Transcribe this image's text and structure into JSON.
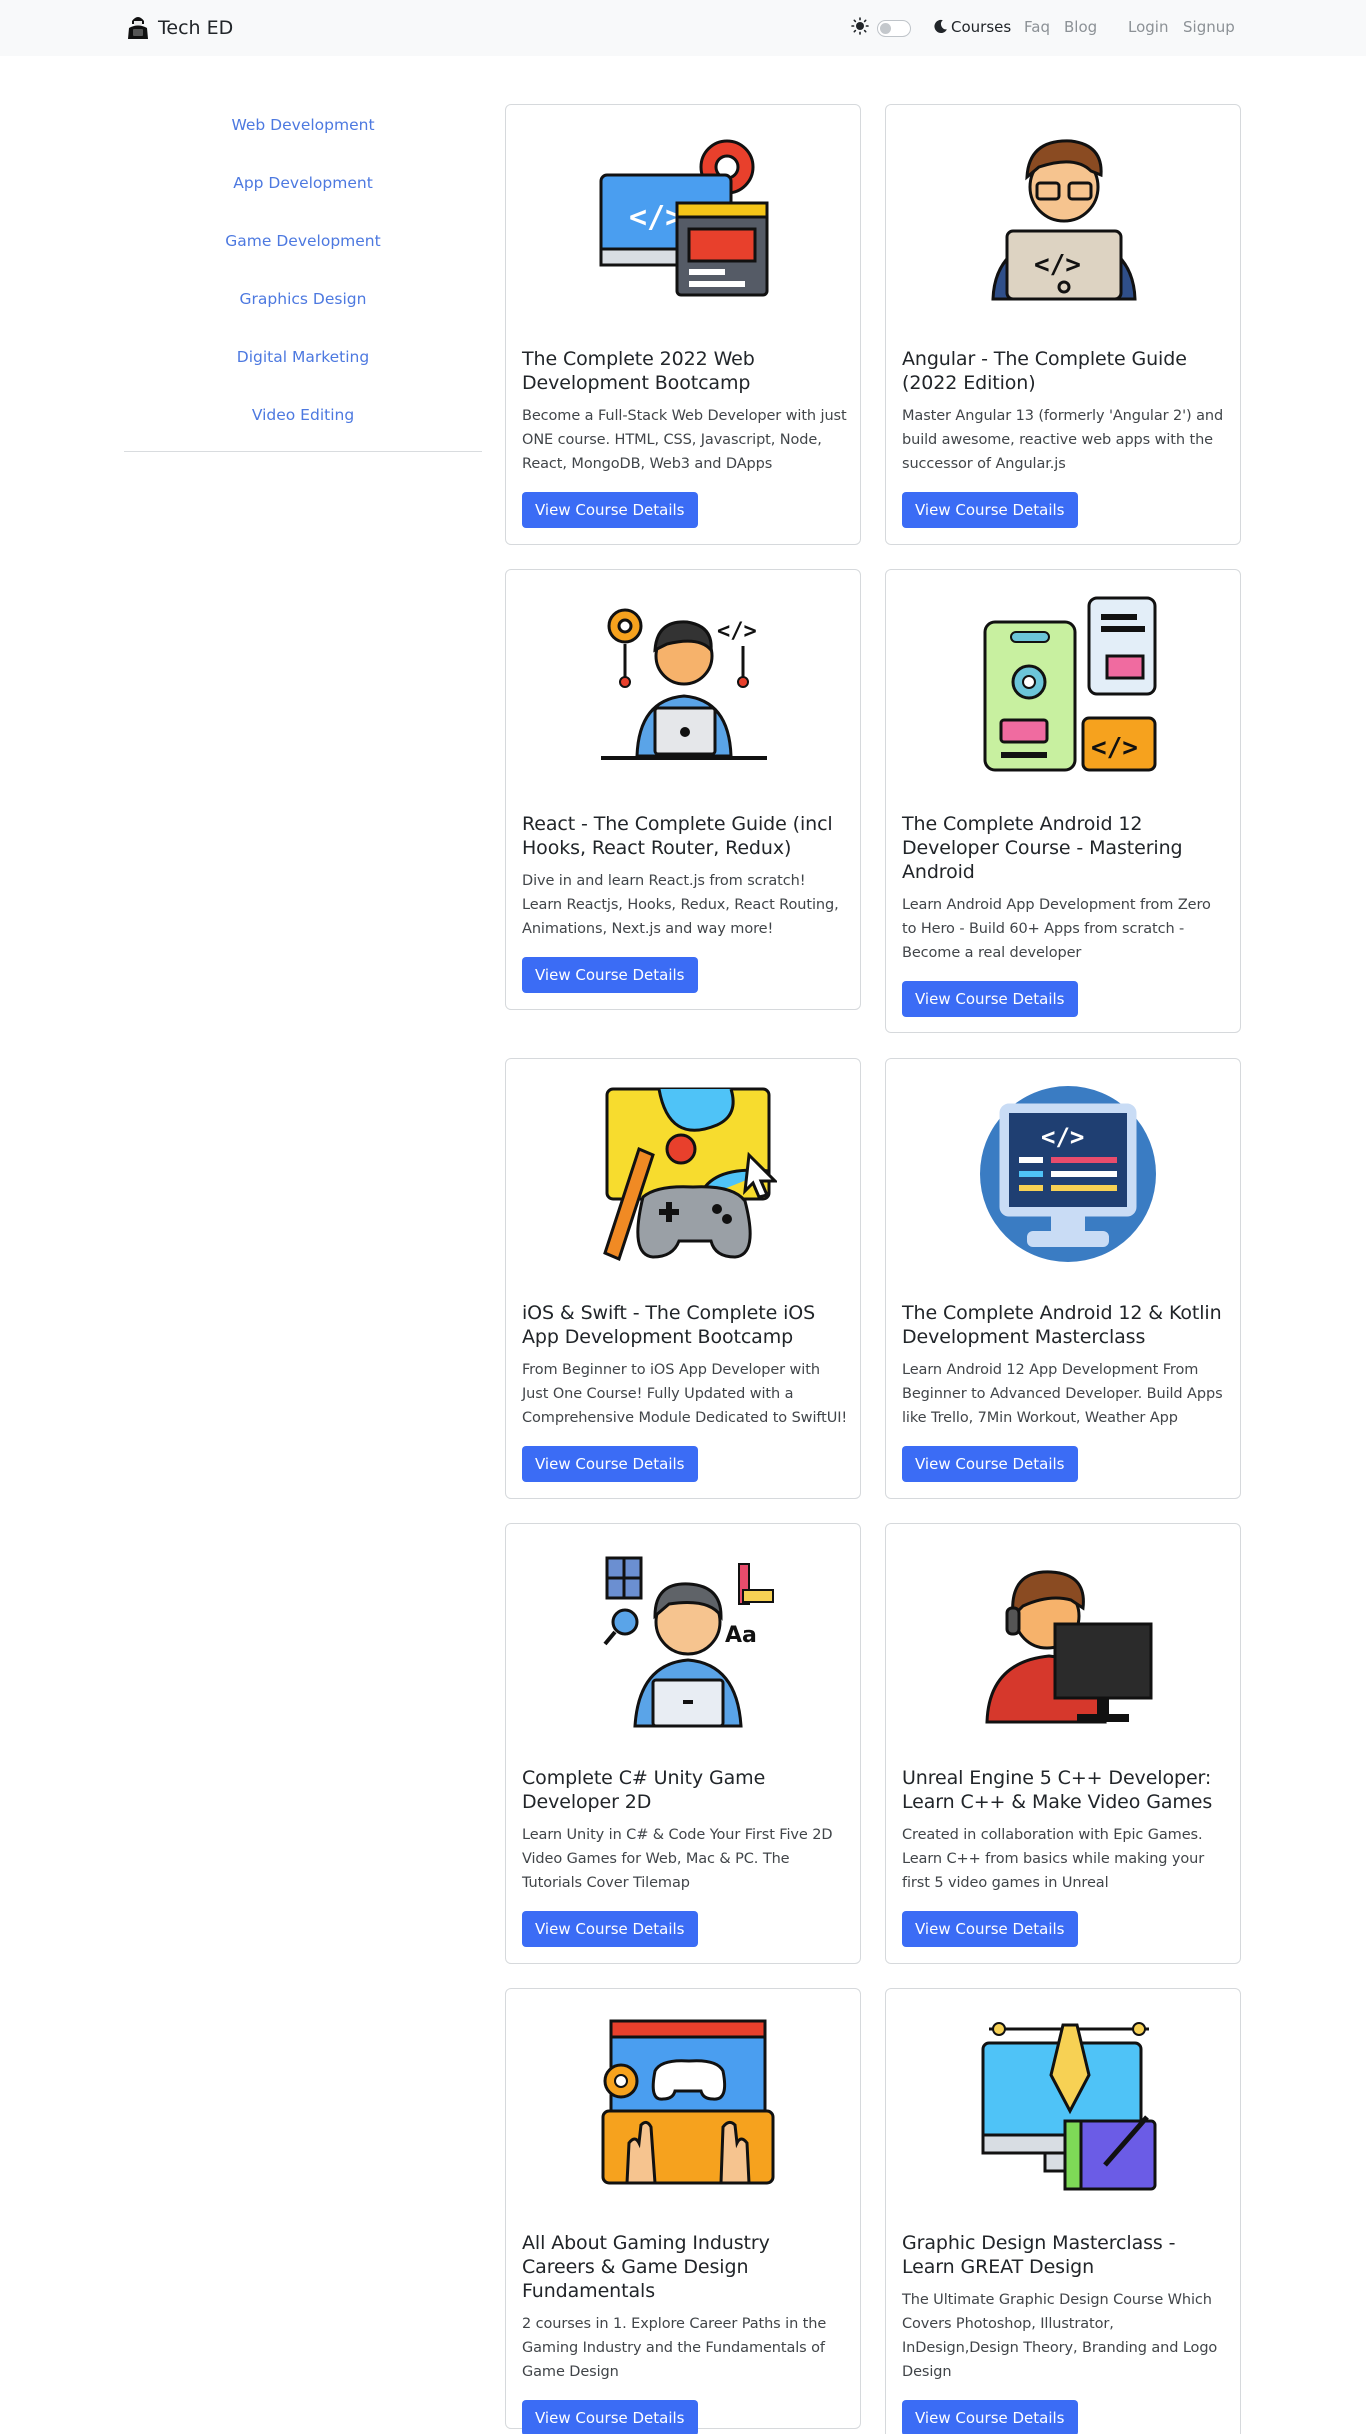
{
  "navbar": {
    "brand": "Tech ED",
    "links": {
      "courses": "Courses",
      "faq": "Faq",
      "blog": "Blog",
      "login": "Login",
      "signup": "Signup"
    }
  },
  "sidebar": {
    "items": [
      {
        "label": "Web Development"
      },
      {
        "label": "App Development"
      },
      {
        "label": "Game Development"
      },
      {
        "label": "Graphics Design"
      },
      {
        "label": "Digital Marketing"
      },
      {
        "label": "Video Editing"
      }
    ]
  },
  "courses": [
    {
      "title": "The Complete 2022 Web Development Bootcamp",
      "description": "Become a Full-Stack Web Developer with just ONE course. HTML, CSS, Javascript, Node, React, MongoDB, Web3 and DApps",
      "button": "View Course Details",
      "icon": "web-development-icon"
    },
    {
      "title": "Angular - The Complete Guide (2022 Edition)",
      "description": "Master Angular 13 (formerly 'Angular 2') and build awesome, reactive web apps with the successor of Angular.js",
      "button": "View Course Details",
      "icon": "programmer-icon"
    },
    {
      "title": "React - The Complete Guide (incl Hooks, React Router, Redux)",
      "description": "Dive in and learn React.js from scratch! Learn Reactjs, Hooks, Redux, React Routing, Animations, Next.js and way more!",
      "button": "View Course Details",
      "icon": "developer-icon"
    },
    {
      "title": "The Complete Android 12 Developer Course - Mastering Android",
      "description": "Learn Android App Development from Zero to Hero - Build 60+ Apps from scratch - Become a real developer",
      "button": "View Course Details",
      "icon": "mobile-app-icon"
    },
    {
      "title": "iOS & Swift - The Complete iOS App Development Bootcamp",
      "description": "From Beginner to iOS App Developer with Just One Course! Fully Updated with a Comprehensive Module Dedicated to SwiftUI!",
      "button": "View Course Details",
      "icon": "game-design-icon"
    },
    {
      "title": "The Complete Android 12 & Kotlin Development Masterclass",
      "description": "Learn Android 12 App Development From Beginner to Advanced Developer. Build Apps like Trello, 7Min Workout, Weather App",
      "button": "View Course Details",
      "icon": "code-monitor-icon"
    },
    {
      "title": "Complete C# Unity Game Developer 2D",
      "description": "Learn Unity in C# & Code Your First Five 2D Video Games for Web, Mac & PC. The Tutorials Cover Tilemap",
      "button": "View Course Details",
      "icon": "designer-icon"
    },
    {
      "title": "Unreal Engine 5 C++ Developer: Learn C++ & Make Video Games",
      "description": "Created in collaboration with Epic Games. Learn C++ from basics while making your first 5 video games in Unreal",
      "button": "View Course Details",
      "icon": "gamer-icon"
    },
    {
      "title": "All About Gaming Industry Careers & Game Design Fundamentals",
      "description": "2 courses in 1. Explore Career Paths in the Gaming Industry and the Fundamentals of Game Design",
      "button": "View Course Details",
      "icon": "game-development-icon"
    },
    {
      "title": "Graphic Design Masterclass - Learn GREAT Design",
      "description": "The Ultimate Graphic Design Course Which Covers Photoshop, Illustrator, InDesign,Design Theory, Branding and Logo Design",
      "button": "View Course Details",
      "icon": "graphic-design-icon"
    }
  ],
  "colors": {
    "accent": "#3b6cf5",
    "sidebar_link": "#4d79e0",
    "navbar_bg": "#f8f9fa"
  }
}
